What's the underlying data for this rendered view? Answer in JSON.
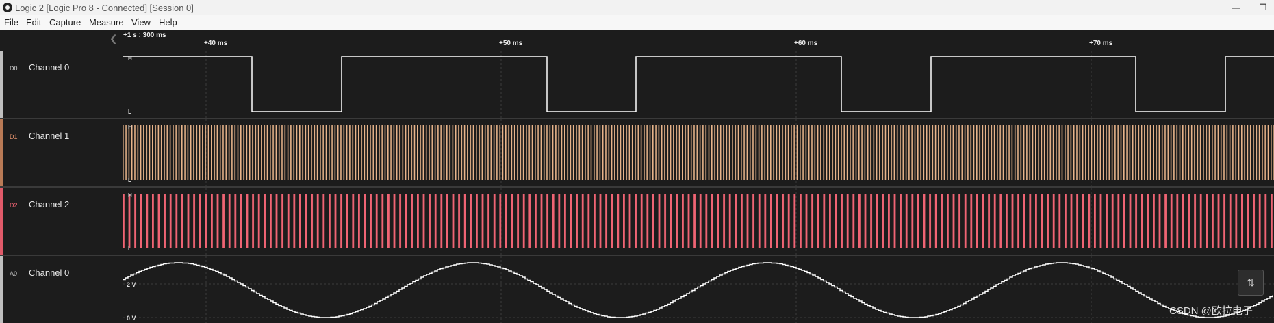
{
  "window": {
    "title": "Logic 2 [Logic Pro 8 - Connected] [Session 0]",
    "minimize_glyph": "—",
    "restore_glyph": "❐"
  },
  "menu": [
    "File",
    "Edit",
    "Capture",
    "Measure",
    "View",
    "Help"
  ],
  "timeline": {
    "origin": "+1 s : 300 ms",
    "ticks": [
      "+40 ms",
      "+50 ms",
      "+60 ms",
      "+70 ms"
    ]
  },
  "channels": [
    {
      "id": "D0",
      "name": "Channel 0",
      "color": "#ffffff",
      "bar_color": "#bfbfbf",
      "type": "digital"
    },
    {
      "id": "D1",
      "name": "Channel 1",
      "color": "#e8b48a",
      "bar_color": "#b97a56",
      "type": "digital"
    },
    {
      "id": "D2",
      "name": "Channel 2",
      "color": "#f06474",
      "bar_color": "#e05a69",
      "type": "digital"
    },
    {
      "id": "A0",
      "name": "Channel 0",
      "color": "#ffffff",
      "bar_color": "#bfbfbf",
      "type": "analog"
    }
  ],
  "level_labels": {
    "high": "H",
    "low": "L"
  },
  "analog_labels": {
    "mid": "2 V",
    "low": "0 V"
  },
  "icons": {
    "collapse": "chevron-left-icon",
    "fit": "fit-vertical-icon",
    "app": "logic-app-icon"
  },
  "watermark": "CSDN @欧拉电子"
}
